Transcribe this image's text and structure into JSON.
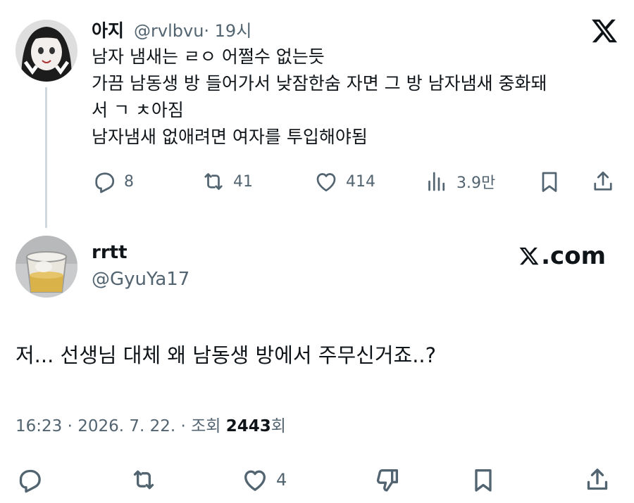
{
  "parent_tweet": {
    "display_name": "아지",
    "handle": "@rvlbvu",
    "time": " · 19시",
    "lines": [
      "남자 냄새는 ㄹㅇ 어쩔수 없는듯",
      "가끔 남동생 방 들어가서 낮잠한숨 자면 그 방 남자냄새 중화돼",
      "서 ㄱ ㅊ아짐",
      "남자냄새 없애려면 여자를 투입해야됨"
    ],
    "actions": {
      "replies": "8",
      "retweets": "41",
      "likes": "414",
      "views": "3.9만"
    },
    "icons": [
      "reply-icon",
      "retweet-icon",
      "like-icon",
      "views-icon",
      "bookmark-icon",
      "share-icon",
      "x-logo-icon"
    ]
  },
  "reply_tweet": {
    "display_name": "rrtt",
    "handle": "@GyuYa17",
    "brand": ".com",
    "text": "저... 선생님 대체 왜 남동생 방에서 주무신거죠..?",
    "meta": {
      "time": "16:23 · 2026. 7. 22. · 조회 ",
      "views": "2443",
      "views_suffix": "회"
    },
    "actions": {
      "likes": "4"
    },
    "icons": [
      "reply-icon",
      "retweet-icon",
      "like-icon",
      "dislike-icon",
      "bookmark-icon",
      "share-icon"
    ]
  },
  "colors": {
    "text": "#0f1419",
    "secondary": "#536471",
    "thread_line": "#cfd9de",
    "background": "#ffffff"
  }
}
